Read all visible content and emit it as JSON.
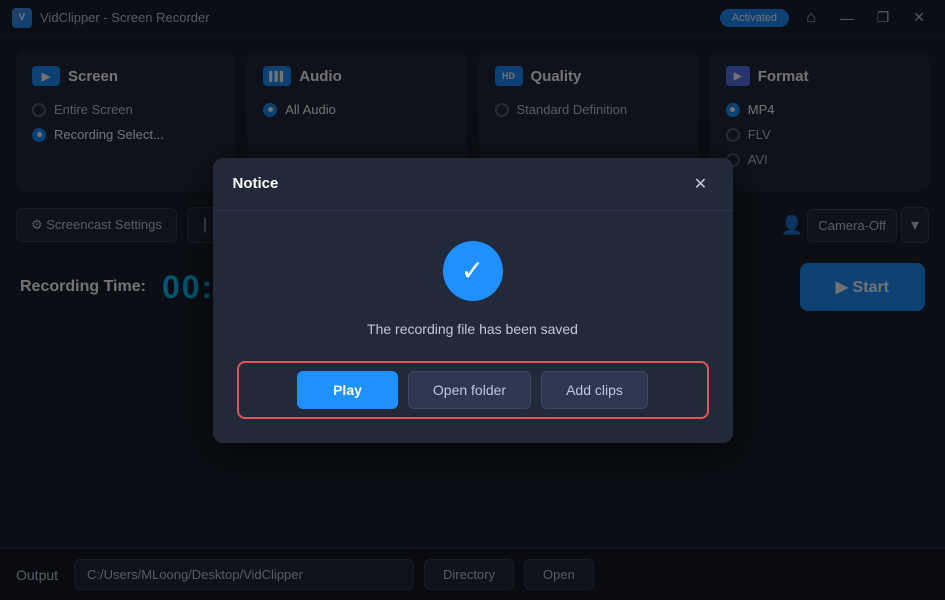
{
  "titleBar": {
    "appName": "VidClipper - Screen Recorder",
    "activated": "Activated",
    "homeIcon": "⌂",
    "minimizeIcon": "—",
    "maximizeIcon": "❐",
    "closeIcon": "✕"
  },
  "cards": [
    {
      "id": "screen",
      "icon": "▶",
      "iconLabel": "screen-icon",
      "title": "Screen",
      "options": [
        {
          "label": "Entire Screen",
          "selected": false
        },
        {
          "label": "Recording Select...",
          "selected": true
        }
      ]
    },
    {
      "id": "audio",
      "icon": "▌▌▌",
      "iconLabel": "audio-icon",
      "title": "Audio",
      "options": [
        {
          "label": "All Audio",
          "selected": true
        }
      ]
    },
    {
      "id": "quality",
      "icon": "HD",
      "iconLabel": "quality-icon",
      "title": "Quality",
      "options": [
        {
          "label": "Standard Definition",
          "selected": false
        }
      ]
    },
    {
      "id": "format",
      "icon": "▶",
      "iconLabel": "format-icon",
      "title": "Format",
      "options": [
        {
          "label": "MP4",
          "selected": true
        },
        {
          "label": "FLV",
          "selected": false
        },
        {
          "label": "AVI",
          "selected": false
        }
      ]
    }
  ],
  "controls": {
    "screencastSettings": "⚙ Screencast Settings",
    "cameraOff": "Camera-Off",
    "chevron": "▾"
  },
  "recording": {
    "label": "Recording Time:",
    "time": "00:00:00",
    "startBtn": "▶  Start"
  },
  "output": {
    "label": "Output",
    "path": "C:/Users/MLoong/Desktop/VidClipper",
    "directoryBtn": "Directory",
    "openBtn": "Open"
  },
  "modal": {
    "title": "Notice",
    "closeIcon": "✕",
    "checkIcon": "✓",
    "message": "The recording file has been saved",
    "playBtn": "Play",
    "openFolderBtn": "Open folder",
    "addClipsBtn": "Add clips"
  }
}
